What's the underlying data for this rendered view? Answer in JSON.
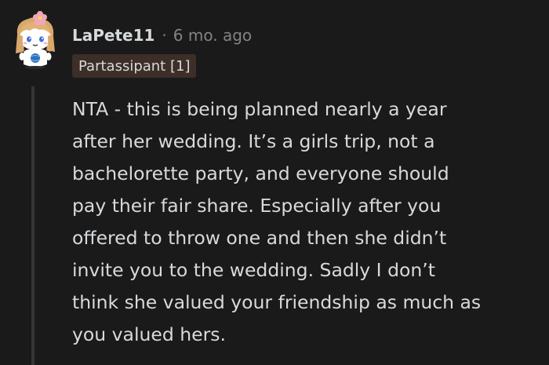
{
  "comment": {
    "author": "LaPete11",
    "separator": "·",
    "time": "6 mo. ago",
    "flair": "Partassipant [1]",
    "body_lines": [
      "NTA - this is being planned nearly a year",
      "after her wedding. It’s a girls trip, not a",
      "bachelorette party, and everyone should",
      "pay their fair share. Especially after you",
      "offered to throw one and then she didn’t",
      "invite you to the wedding. Sadly I don’t",
      "think she valued your friendship as much as",
      "you valued hers."
    ]
  },
  "colors": {
    "background": "#1a1a1b",
    "text": "#d7dadc",
    "meta": "#818384",
    "flair_bg": "#3d2e28",
    "thread_line": "#343536"
  }
}
